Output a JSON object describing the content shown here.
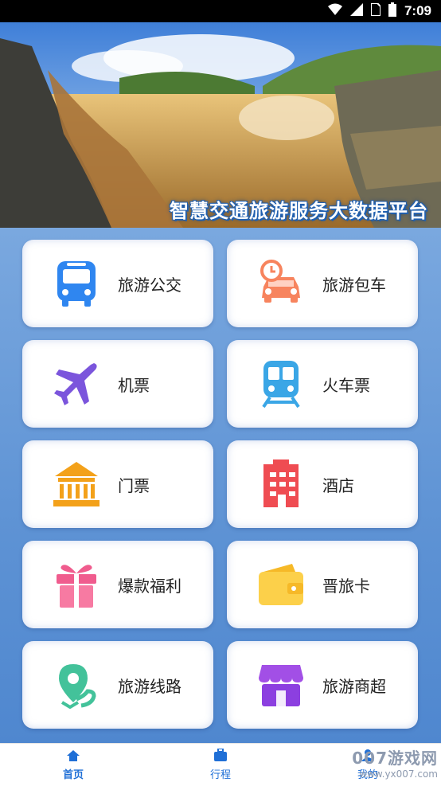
{
  "status_bar": {
    "time": "7:09",
    "icons": [
      "wifi-icon",
      "signal-icon",
      "sim-icon",
      "battery-icon"
    ]
  },
  "banner": {
    "title": "智慧交通旅游服务大数据平台"
  },
  "menu": {
    "items": [
      {
        "label": "旅游公交",
        "icon": "bus-icon"
      },
      {
        "label": "旅游包车",
        "icon": "car-rental-icon"
      },
      {
        "label": "机票",
        "icon": "airplane-icon"
      },
      {
        "label": "火车票",
        "icon": "train-icon"
      },
      {
        "label": "门票",
        "icon": "temple-icon"
      },
      {
        "label": "酒店",
        "icon": "hotel-icon"
      },
      {
        "label": "爆款福利",
        "icon": "gift-icon"
      },
      {
        "label": "晋旅卡",
        "icon": "wallet-icon"
      },
      {
        "label": "旅游线路",
        "icon": "route-pin-icon"
      },
      {
        "label": "旅游商超",
        "icon": "store-icon"
      }
    ]
  },
  "bottom_nav": {
    "home": "首页",
    "trip": "行程",
    "mine": "我的"
  },
  "watermark": {
    "main": "007游戏网",
    "sub": "www.yx007.com"
  },
  "colors": {
    "accent": "#1f6fd6",
    "grid_bg": "#5d92d4"
  }
}
